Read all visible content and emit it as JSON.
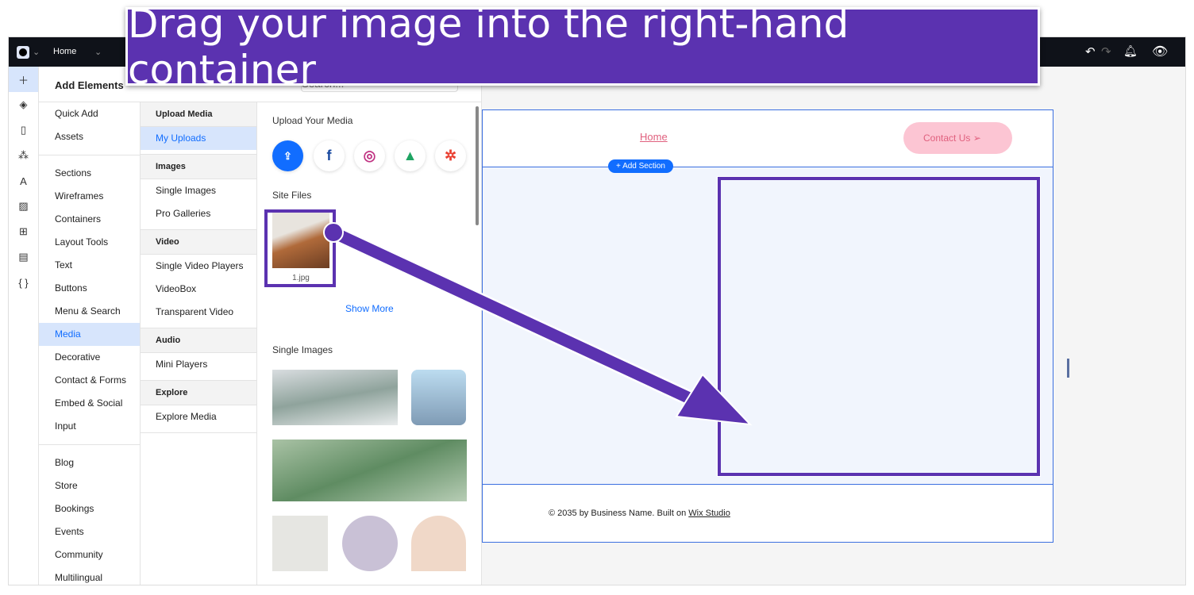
{
  "banner": "Drag your image into the right-hand container",
  "topbar": {
    "page": "Home"
  },
  "panel": {
    "title": "Add Elements",
    "search_placeholder": "Search...",
    "categories": [
      "Quick Add",
      "Assets",
      "Sections",
      "Wireframes",
      "Containers",
      "Layout Tools",
      "Text",
      "Buttons",
      "Menu & Search",
      "Media",
      "Decorative",
      "Contact & Forms",
      "Embed & Social",
      "Input",
      "Blog",
      "Store",
      "Bookings",
      "Events",
      "Community",
      "Multilingual"
    ],
    "subgroups": [
      {
        "header": "Upload Media",
        "items": [
          "My Uploads"
        ]
      },
      {
        "header": "Images",
        "items": [
          "Single Images",
          "Pro Galleries"
        ]
      },
      {
        "header": "Video",
        "items": [
          "Single Video Players",
          "VideoBox",
          "Transparent Video"
        ]
      },
      {
        "header": "Audio",
        "items": [
          "Mini Players"
        ]
      },
      {
        "header": "Explore",
        "items": [
          "Explore Media"
        ]
      }
    ],
    "upload_title": "Upload Your Media",
    "site_files": "Site Files",
    "file_name": "1.jpg",
    "show_more": "Show More",
    "single_images": "Single Images"
  },
  "site": {
    "nav_home": "Home",
    "contact": "Contact Us",
    "add_section": "+ Add Section",
    "footer": "© 2035 by Business Name. Built on ",
    "footer_link": "Wix Studio"
  },
  "colors": {
    "accent": "#116dff",
    "annotation": "#5b32b0",
    "contact_bg": "#fcc5d3"
  }
}
